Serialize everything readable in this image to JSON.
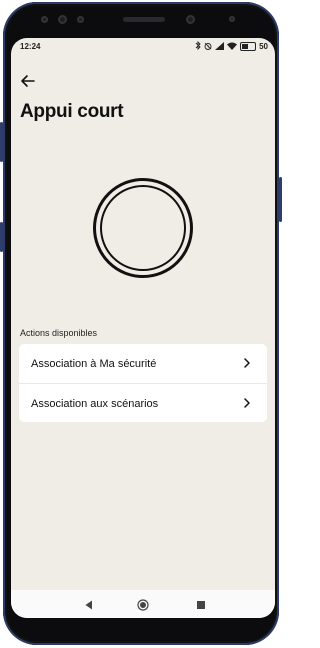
{
  "status_bar": {
    "time": "12:24",
    "battery": "50",
    "icons": [
      "bluetooth-icon",
      "alarm-icon",
      "signal-icon",
      "wifi-icon",
      "battery-icon"
    ]
  },
  "header": {
    "back_icon": "arrow-left-icon",
    "title": "Appui court"
  },
  "actions": {
    "section_label": "Actions disponibles",
    "items": [
      {
        "label": "Association à Ma sécurité",
        "icon": "chevron-right-icon"
      },
      {
        "label": "Association aux scénarios",
        "icon": "chevron-right-icon"
      }
    ]
  },
  "nav_bar": {
    "buttons": [
      "back-triangle-icon",
      "home-circle-icon",
      "recents-square-icon"
    ]
  },
  "colors": {
    "screen_background": "#f0ede6",
    "card_background": "#ffffff",
    "text": "#111111"
  }
}
